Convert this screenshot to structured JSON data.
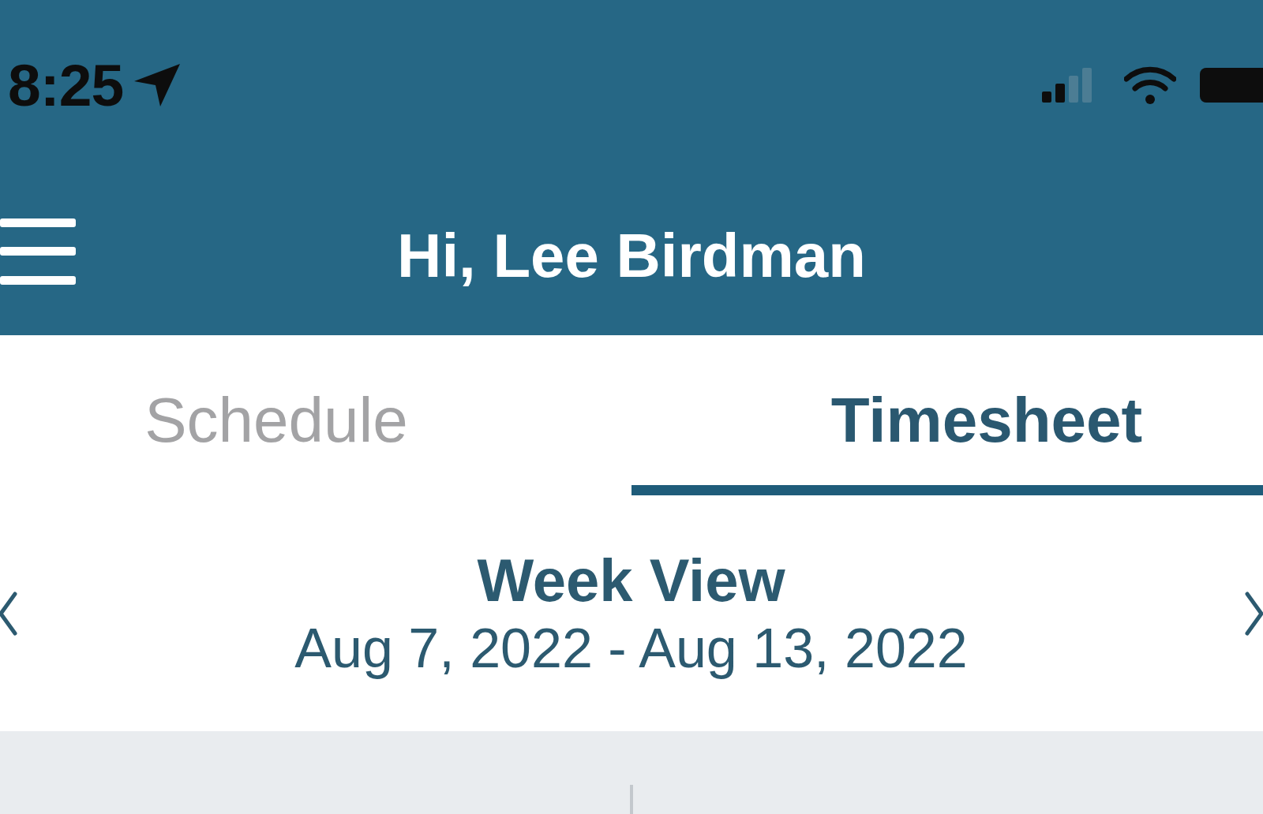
{
  "status_bar": {
    "time": "8:25"
  },
  "header": {
    "title": "Hi, Lee Birdman"
  },
  "tabs": [
    {
      "label": "Schedule",
      "selected": false
    },
    {
      "label": "Timesheet",
      "selected": true
    }
  ],
  "week_view": {
    "title": "Week View",
    "date_range": "Aug 7, 2022 - Aug 13, 2022"
  }
}
